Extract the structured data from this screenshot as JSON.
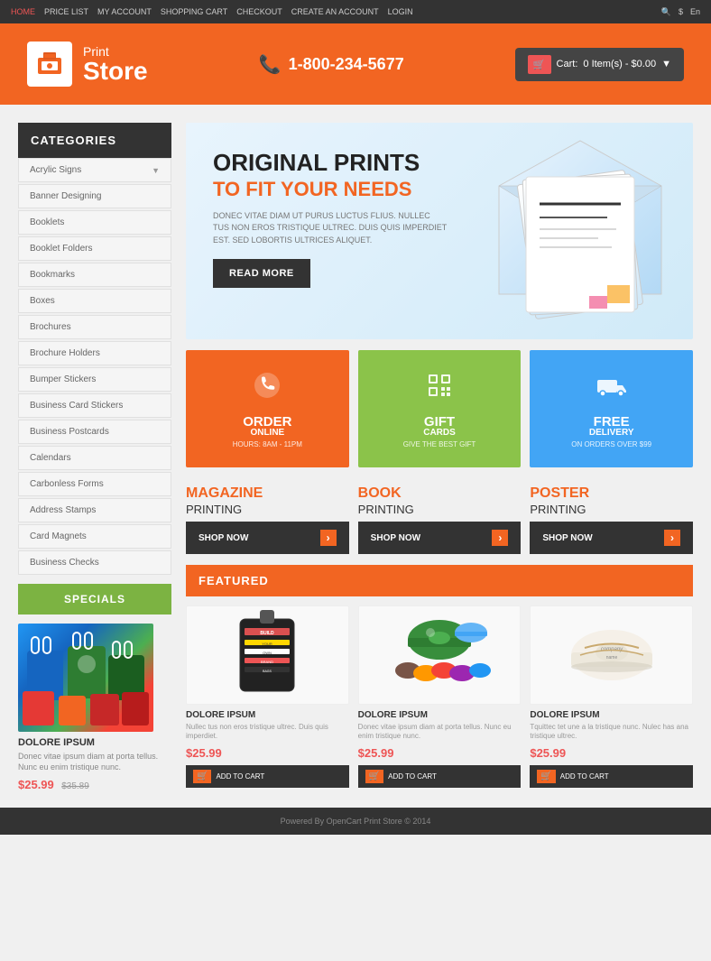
{
  "topbar": {
    "links": [
      "HOME",
      "PRICE LIST",
      "MY ACCOUNT",
      "SHOPPING CART",
      "CHECKOUT",
      "CREATE AN ACCOUNT",
      "LOGIN"
    ],
    "active_link": "HOME",
    "search_icon": "🔍",
    "currency": "$",
    "language": "En"
  },
  "header": {
    "logo_print": "Print",
    "logo_store": "Store",
    "phone": "1-800-234-5677",
    "cart_label": "Cart:",
    "cart_items": "0 Item(s) - $0.00"
  },
  "sidebar": {
    "categories_title": "CATEGORIES",
    "items": [
      {
        "label": "Acrylic Signs",
        "has_arrow": true
      },
      {
        "label": "Banner Designing"
      },
      {
        "label": "Booklets"
      },
      {
        "label": "Booklet Folders"
      },
      {
        "label": "Bookmarks"
      },
      {
        "label": "Boxes"
      },
      {
        "label": "Brochures"
      },
      {
        "label": "Brochure Holders"
      },
      {
        "label": "Bumper Stickers"
      },
      {
        "label": "Business Card Stickers"
      },
      {
        "label": "Business Postcards"
      },
      {
        "label": "Calendars"
      },
      {
        "label": "Carbonless Forms"
      },
      {
        "label": "Address Stamps"
      },
      {
        "label": "Card Magnets"
      },
      {
        "label": "Business Checks"
      }
    ],
    "specials_label": "SPECIALS",
    "product": {
      "name": "DOLORE IPSUM",
      "desc": "Donec vitae ipsum diam at porta tellus. Nunc eu enim tristique nunc.",
      "price": "$25.99",
      "old_price": "$35.89"
    }
  },
  "hero": {
    "title": "ORIGINAL PRINTS",
    "subtitle": "TO FIT YOUR NEEDS",
    "desc": "DONEC VITAE DIAM UT PURUS LUCTUS FLIUS. NULLEC TUS NON EROS TRISTIQUE ULTREC. DUIS QUIS IMPERDIET EST. SED LOBORTIS ULTRICES ALIQUET.",
    "btn_label": "READ MORE"
  },
  "features": [
    {
      "icon": "📞",
      "title": "ORDER",
      "subtitle": "ONLINE",
      "note": "HOURS: 8AM - 11PM",
      "color": "orange"
    },
    {
      "icon": "⬛",
      "title": "GIFT",
      "subtitle": "CARDS",
      "note": "GIVE THE BEST GIFT",
      "color": "green"
    },
    {
      "icon": "🚚",
      "title": "FREE",
      "subtitle": "DELIVERY",
      "note": "ON ORDERS OVER $99",
      "color": "blue"
    }
  ],
  "print_sections": [
    {
      "type": "MAGAZINE",
      "word": "PRINTING",
      "btn": "SHOP NOW"
    },
    {
      "type": "BOOK",
      "word": "PRINTING",
      "btn": "SHOP NOW"
    },
    {
      "type": "POSTER",
      "word": "PRINTING",
      "btn": "SHOP NOW"
    }
  ],
  "featured": {
    "title": "FEATURED",
    "products": [
      {
        "name": "DOLORE IPSUM",
        "desc": "Donec vitae ipsum diam at porta tellus. Nunc eu enim tristique nunc.",
        "price": "$25.99",
        "btn": "ADD TO CART"
      },
      {
        "name": "DOLORE IPSUM",
        "desc": "Nullec tus non eros tristique ultrec. Duis quis imperdiet.",
        "price": "$25.99",
        "btn": "ADD TO CART"
      },
      {
        "name": "DOLORE IPSUM",
        "desc": "Tquittec tet une a la tristique nunc. Nulec has ana tristique ultrec.",
        "price": "$25.99",
        "btn": "ADD TO CART"
      }
    ]
  },
  "footer": {
    "text": "Powered By OpenCart Print Store © 2014"
  }
}
